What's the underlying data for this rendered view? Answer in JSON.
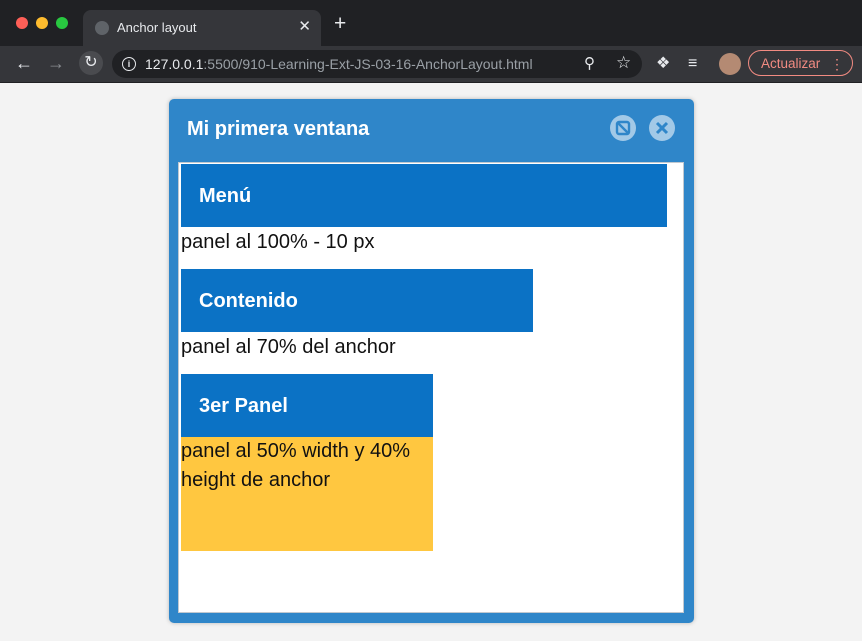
{
  "browser": {
    "tab_title": "Anchor layout",
    "tab_close": "✕",
    "new_tab": "+",
    "url_host": "127.0.0.1",
    "url_rest": ":5500/910-Learning-Ext-JS-03-16-AnchorLayout.html",
    "update_label": "Actualizar",
    "icons": [
      "back-icon",
      "forward-icon",
      "reload-icon",
      "info-icon",
      "zoom-icon",
      "star-icon",
      "extensions-icon",
      "media-icon",
      "profile-avatar",
      "menu-dots-icon"
    ]
  },
  "window": {
    "title": "Mi primera ventana",
    "panels": [
      {
        "title": "Menú",
        "text": "panel al 100% - 10 px"
      },
      {
        "title": "Contenido",
        "text": "panel al 70% del anchor"
      },
      {
        "title": "3er Panel",
        "text": "panel al 50% width y 40% height de anchor"
      }
    ]
  },
  "colors": {
    "window_header": "#2f86c9",
    "panel_header": "#0b72c5",
    "panel3_body": "#ffc740",
    "update_button": "#f28b82"
  }
}
